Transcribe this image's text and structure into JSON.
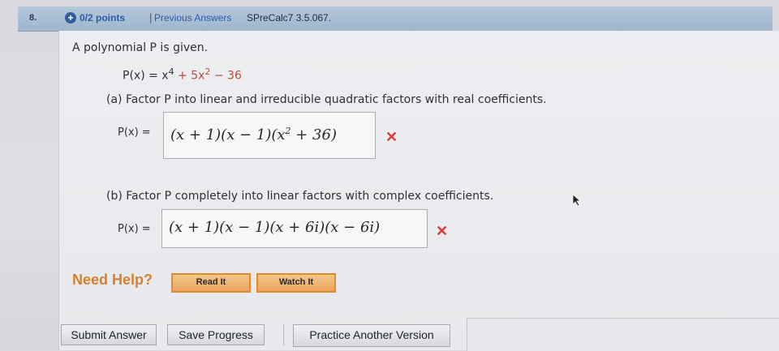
{
  "header": {
    "question_number": "8.",
    "points": "0/2 points",
    "separator": "|",
    "previous_answers": "Previous Answers",
    "question_code": "SPreCalc7 3.5.067."
  },
  "problem": {
    "intro": "A polynomial P is given.",
    "polynomial_lhs": "P(x) = x",
    "poly_exp1": "4",
    "poly_mid": " + 5x",
    "poly_exp2": "2",
    "poly_tail": " − 36"
  },
  "part_a": {
    "prompt": "(a) Factor P into linear and irreducible quadratic factors with real coefficients.",
    "label": "P(x) =",
    "answer_main": "(x + 1)(x − 1)(x",
    "answer_exp": "2",
    "answer_tail": " + 36)",
    "status": "✕"
  },
  "part_b": {
    "prompt": "(b) Factor P completely into linear factors with complex coefficients.",
    "label": "P(x) =",
    "answer": "(x + 1)(x − 1)(x + 6i)(x − 6i)",
    "status": "✕"
  },
  "help": {
    "label": "Need Help?",
    "read_it": "Read It",
    "watch_it": "Watch It"
  },
  "actions": {
    "submit": "Submit Answer",
    "save": "Save Progress",
    "practice": "Practice Another Version"
  },
  "colors": {
    "header_bg": "#a9bed3",
    "error_red": "#dc3a3a",
    "help_orange": "#e38a2e"
  }
}
